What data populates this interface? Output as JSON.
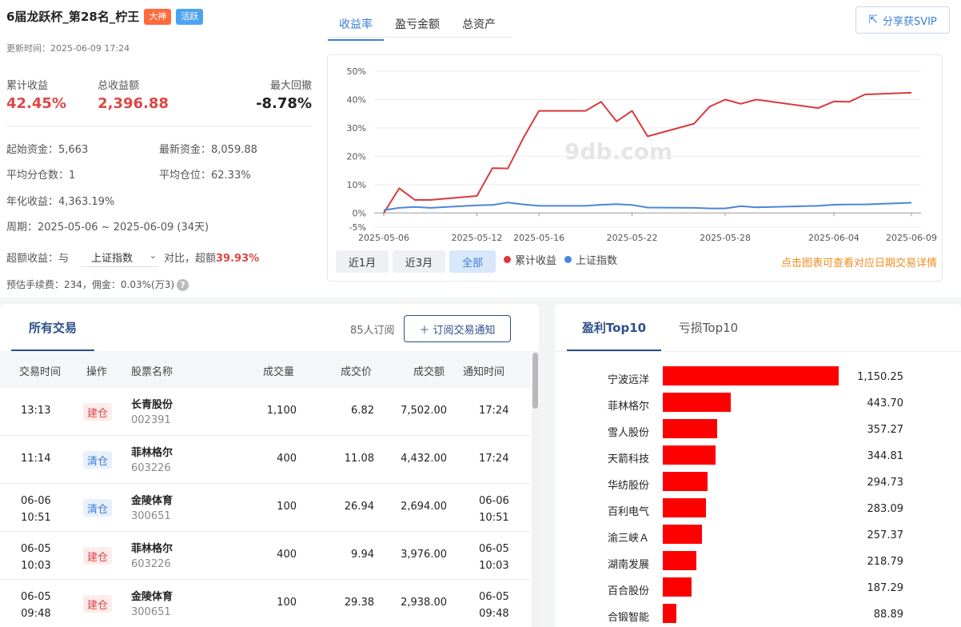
{
  "header": {
    "title": "6届龙跃杯_第28名_柠王",
    "badges": [
      "大神",
      "活跃"
    ],
    "update_time": "更新时间：2025-06-09 17:24"
  },
  "stats": {
    "cum_label": "累计收益",
    "cum_value": "42.45%",
    "total_label": "总收益额",
    "total_value": "2,396.88",
    "dd_label": "最大回撤",
    "dd_value": "-8.78%"
  },
  "info": {
    "start_capital": "起始资金：5,663",
    "latest_capital": "最新资金：8,059.88",
    "avg_split": "平均分仓数：1",
    "avg_position": "平均仓位：62.33%",
    "annual": "年化收益：4,363.19%",
    "period": "周期：2025-05-06 ~ 2025-06-09 (34天)",
    "excess_prefix": "超额收益：与",
    "benchmark": "上证指数",
    "excess_mid": "对比，超额",
    "excess_value": "39.93%",
    "fee": "预估手续费：234，佣金：0.03%(万3)"
  },
  "chart_tabs": [
    "收益率",
    "盈亏金额",
    "总资产"
  ],
  "share_label": "分享获SVIP",
  "range_buttons": [
    "近1月",
    "近3月",
    "全部"
  ],
  "chart_hint": "点击图表可查看对应日期交易详情",
  "watermark": "9db.com",
  "colors": {
    "cum": "#d9393f",
    "index": "#4a86d8",
    "accent": "#3b7fd4",
    "bar": "#ff0000"
  },
  "chart_data": {
    "type": "line",
    "x_ticks": [
      "2025-05-06",
      "2025-05-12",
      "2025-05-16",
      "2025-05-22",
      "2025-05-28",
      "2025-06-04",
      "2025-06-09"
    ],
    "y_ticks": [
      "50%",
      "40%",
      "30%",
      "20%",
      "10%",
      "0%",
      "-5%"
    ],
    "ylim": [
      -5,
      50
    ],
    "series": [
      {
        "name": "累计收益",
        "dates": [
          "2025-05-06",
          "2025-05-07",
          "2025-05-08",
          "2025-05-09",
          "2025-05-12",
          "2025-05-13",
          "2025-05-14",
          "2025-05-15",
          "2025-05-16",
          "2025-05-19",
          "2025-05-20",
          "2025-05-21",
          "2025-05-22",
          "2025-05-23",
          "2025-05-26",
          "2025-05-27",
          "2025-05-28",
          "2025-05-29",
          "2025-05-30",
          "2025-06-03",
          "2025-06-04",
          "2025-06-05",
          "2025-06-06",
          "2025-06-09"
        ],
        "values": [
          0,
          8.7,
          4.6,
          4.6,
          6.0,
          15.8,
          15.7,
          26.5,
          36.0,
          36.0,
          39.2,
          32.3,
          36.0,
          27.0,
          31.5,
          37.5,
          40.0,
          38.5,
          40.0,
          37.0,
          39.3,
          39.2,
          41.8,
          42.4
        ]
      },
      {
        "name": "上证指数",
        "dates": [
          "2025-05-06",
          "2025-05-07",
          "2025-05-08",
          "2025-05-09",
          "2025-05-12",
          "2025-05-13",
          "2025-05-14",
          "2025-05-15",
          "2025-05-16",
          "2025-05-19",
          "2025-05-20",
          "2025-05-21",
          "2025-05-22",
          "2025-05-23",
          "2025-05-26",
          "2025-05-27",
          "2025-05-28",
          "2025-05-29",
          "2025-05-30",
          "2025-06-03",
          "2025-06-04",
          "2025-06-05",
          "2025-06-06",
          "2025-06-09"
        ],
        "values": [
          1.0,
          1.8,
          2.1,
          1.8,
          2.7,
          2.8,
          3.7,
          3.0,
          2.5,
          2.5,
          2.9,
          3.1,
          2.8,
          1.9,
          1.8,
          1.6,
          1.6,
          2.4,
          2.0,
          2.5,
          2.9,
          3.0,
          3.0,
          3.6
        ]
      }
    ]
  },
  "trades": {
    "tab": "所有交易",
    "sub_count": "85人订阅",
    "sub_button": "＋ 订阅交易通知",
    "headers": [
      "交易时间",
      "操作",
      "股票名称",
      "成交量",
      "成交价",
      "成交额",
      "通知时间"
    ],
    "rows": [
      {
        "time1": "13:13",
        "time2": "",
        "op": "建仓",
        "op_type": "build",
        "name": "长青股份",
        "code": "002391",
        "qty": "1,100",
        "price": "6.82",
        "amount": "7,502.00",
        "n1": "17:24",
        "n2": ""
      },
      {
        "time1": "11:14",
        "time2": "",
        "op": "清仓",
        "op_type": "clear",
        "name": "菲林格尔",
        "code": "603226",
        "qty": "400",
        "price": "11.08",
        "amount": "4,432.00",
        "n1": "17:24",
        "n2": ""
      },
      {
        "time1": "06-06",
        "time2": "10:51",
        "op": "清仓",
        "op_type": "clear",
        "name": "金陵体育",
        "code": "300651",
        "qty": "100",
        "price": "26.94",
        "amount": "2,694.00",
        "n1": "06-06",
        "n2": "10:51"
      },
      {
        "time1": "06-05",
        "time2": "10:03",
        "op": "建仓",
        "op_type": "build",
        "name": "菲林格尔",
        "code": "603226",
        "qty": "400",
        "price": "9.94",
        "amount": "3,976.00",
        "n1": "06-05",
        "n2": "10:03"
      },
      {
        "time1": "06-05",
        "time2": "09:48",
        "op": "建仓",
        "op_type": "build",
        "name": "金陵体育",
        "code": "300651",
        "qty": "100",
        "price": "29.38",
        "amount": "2,938.00",
        "n1": "06-05",
        "n2": "09:48"
      }
    ]
  },
  "top10": {
    "tabs": [
      "盈利Top10",
      "亏损Top10"
    ],
    "items": [
      {
        "name": "宁波远洋",
        "value": 1150.25,
        "label": "1,150.25"
      },
      {
        "name": "菲林格尔",
        "value": 443.7,
        "label": "443.70"
      },
      {
        "name": "雪人股份",
        "value": 357.27,
        "label": "357.27"
      },
      {
        "name": "天箭科技",
        "value": 344.81,
        "label": "344.81"
      },
      {
        "name": "华纺股份",
        "value": 294.73,
        "label": "294.73"
      },
      {
        "name": "百利电气",
        "value": 283.09,
        "label": "283.09"
      },
      {
        "name": "渝三峡Ａ",
        "value": 257.37,
        "label": "257.37"
      },
      {
        "name": "湖南发展",
        "value": 218.79,
        "label": "218.79"
      },
      {
        "name": "百合股份",
        "value": 187.29,
        "label": "187.29"
      },
      {
        "name": "合锻智能",
        "value": 88.89,
        "label": "88.89"
      }
    ]
  }
}
